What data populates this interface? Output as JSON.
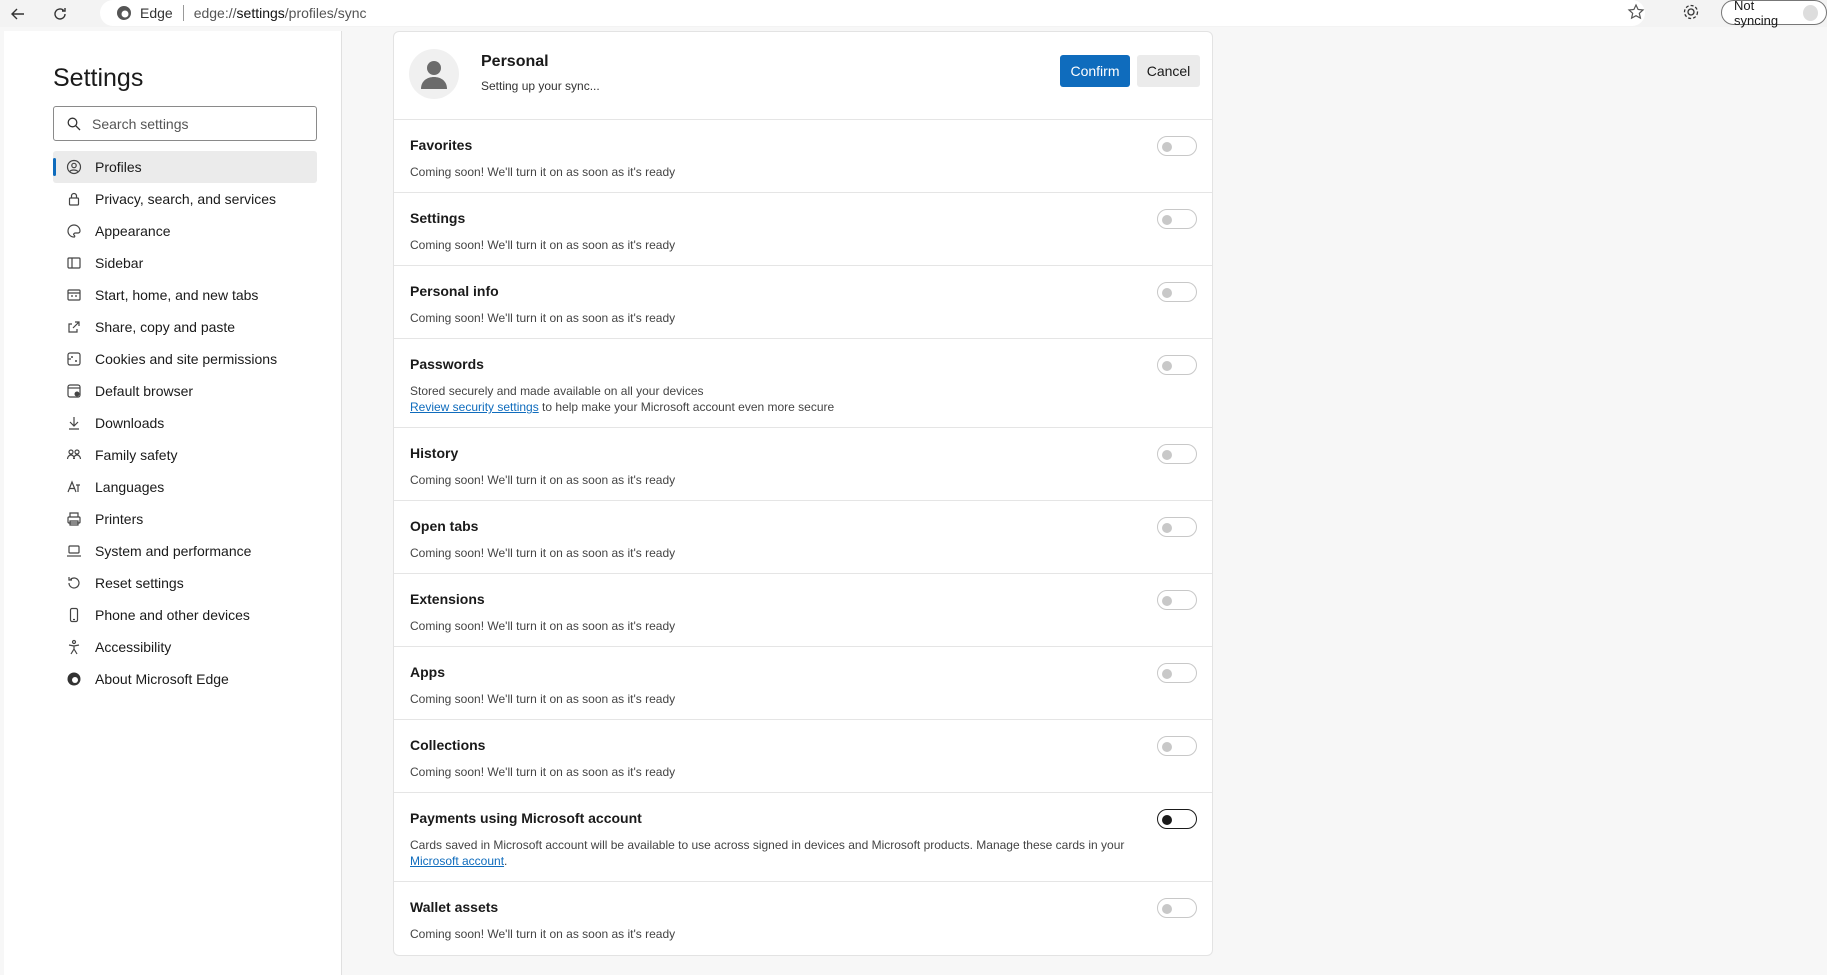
{
  "browser": {
    "site_label": "Edge",
    "url_prefix": "edge://",
    "url_bold": "settings",
    "url_suffix": "/profiles/sync",
    "sync_button": "Not syncing"
  },
  "sidebar": {
    "title": "Settings",
    "search_placeholder": "Search settings",
    "items": [
      {
        "label": "Profiles",
        "icon": "profile-icon"
      },
      {
        "label": "Privacy, search, and services",
        "icon": "lock-icon"
      },
      {
        "label": "Appearance",
        "icon": "palette-icon"
      },
      {
        "label": "Sidebar",
        "icon": "sidebar-icon"
      },
      {
        "label": "Start, home, and new tabs",
        "icon": "home-icon"
      },
      {
        "label": "Share, copy and paste",
        "icon": "share-icon"
      },
      {
        "label": "Cookies and site permissions",
        "icon": "cookie-icon"
      },
      {
        "label": "Default browser",
        "icon": "browser-icon"
      },
      {
        "label": "Downloads",
        "icon": "download-icon"
      },
      {
        "label": "Family safety",
        "icon": "family-icon"
      },
      {
        "label": "Languages",
        "icon": "language-icon"
      },
      {
        "label": "Printers",
        "icon": "printer-icon"
      },
      {
        "label": "System and performance",
        "icon": "laptop-icon"
      },
      {
        "label": "Reset settings",
        "icon": "reset-icon"
      },
      {
        "label": "Phone and other devices",
        "icon": "phone-icon"
      },
      {
        "label": "Accessibility",
        "icon": "accessibility-icon"
      },
      {
        "label": "About Microsoft Edge",
        "icon": "edge-icon"
      }
    ]
  },
  "profile": {
    "name": "Personal",
    "status": "Setting up your sync...",
    "confirm_label": "Confirm",
    "cancel_label": "Cancel"
  },
  "sync_items": [
    {
      "title": "Favorites",
      "desc": "Coming soon! We'll turn it on as soon as it's ready"
    },
    {
      "title": "Settings",
      "desc": "Coming soon! We'll turn it on as soon as it's ready"
    },
    {
      "title": "Personal info",
      "desc": "Coming soon! We'll turn it on as soon as it's ready"
    },
    {
      "title": "Passwords",
      "desc": "Stored securely and made available on all your devices",
      "link": "Review security settings",
      "desc_after_link": " to help make your Microsoft account even more secure"
    },
    {
      "title": "History",
      "desc": "Coming soon! We'll turn it on as soon as it's ready"
    },
    {
      "title": "Open tabs",
      "desc": "Coming soon! We'll turn it on as soon as it's ready"
    },
    {
      "title": "Extensions",
      "desc": "Coming soon! We'll turn it on as soon as it's ready"
    },
    {
      "title": "Apps",
      "desc": "Coming soon! We'll turn it on as soon as it's ready"
    },
    {
      "title": "Collections",
      "desc": "Coming soon! We'll turn it on as soon as it's ready"
    },
    {
      "title": "Payments using Microsoft account",
      "desc": "Cards saved in Microsoft account will be available to use across signed in devices and Microsoft products. Manage these cards in your ",
      "link": "Microsoft account",
      "desc_after_link": "."
    },
    {
      "title": "Wallet assets",
      "desc": "Coming soon! We'll turn it on as soon as it's ready"
    }
  ],
  "colors": {
    "accent": "#0f6cbd",
    "toggle_disabled": "#c8c8c8"
  }
}
